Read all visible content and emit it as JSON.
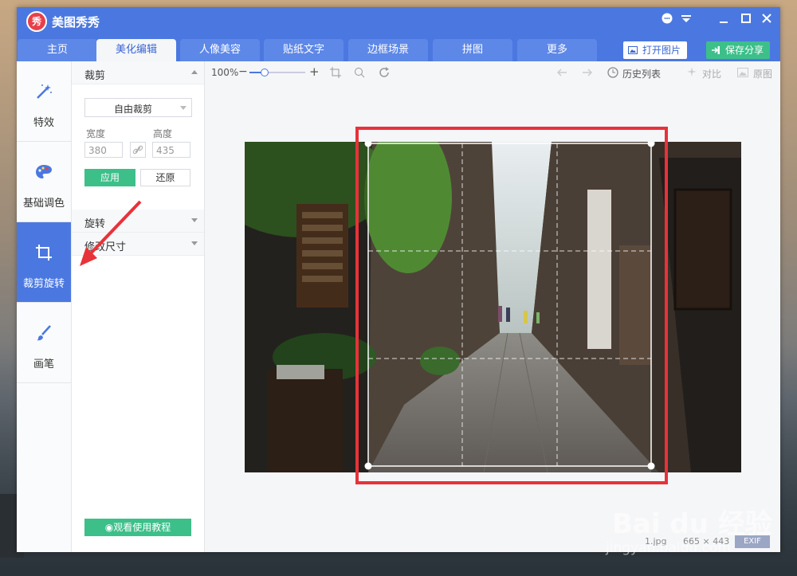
{
  "window": {
    "app_title": "美图秀秀",
    "logo_text": "秀"
  },
  "tabs": [
    {
      "label": "主页"
    },
    {
      "label": "美化编辑",
      "active": true
    },
    {
      "label": "人像美容"
    },
    {
      "label": "贴纸文字"
    },
    {
      "label": "边框场景"
    },
    {
      "label": "拼图"
    },
    {
      "label": "更多"
    }
  ],
  "actions": {
    "open_label": "打开图片",
    "save_label": "保存分享"
  },
  "sidebar": {
    "items": [
      {
        "label": "特效",
        "icon": "magic-wand-icon"
      },
      {
        "label": "基础调色",
        "icon": "palette-icon"
      },
      {
        "label": "裁剪旋转",
        "icon": "crop-icon",
        "active": true
      },
      {
        "label": "画笔",
        "icon": "brush-icon"
      }
    ]
  },
  "panel": {
    "crop_title": "裁剪",
    "crop_mode": "自由裁剪",
    "width_label": "宽度",
    "height_label": "高度",
    "width_value": "380",
    "height_value": "435",
    "apply_label": "应用",
    "reset_label": "还原",
    "rotate_title": "旋转",
    "resize_title": "修改尺寸",
    "tutorial_label": "观看使用教程"
  },
  "toolbar": {
    "zoom_text": "100%",
    "zoom_level": 0.25,
    "history_label": "历史列表",
    "compare_label": "对比",
    "original_label": "原图"
  },
  "status": {
    "filename": "1.jpg",
    "dimensions": "665 × 443",
    "exif_label": "EXIF"
  },
  "watermark": {
    "brand": "Bai du 经验",
    "site": "jingyan.baidu.com"
  },
  "colors": {
    "accent": "#4b78e0",
    "green": "#3dbf8a",
    "annotation_red": "#e8323a"
  }
}
